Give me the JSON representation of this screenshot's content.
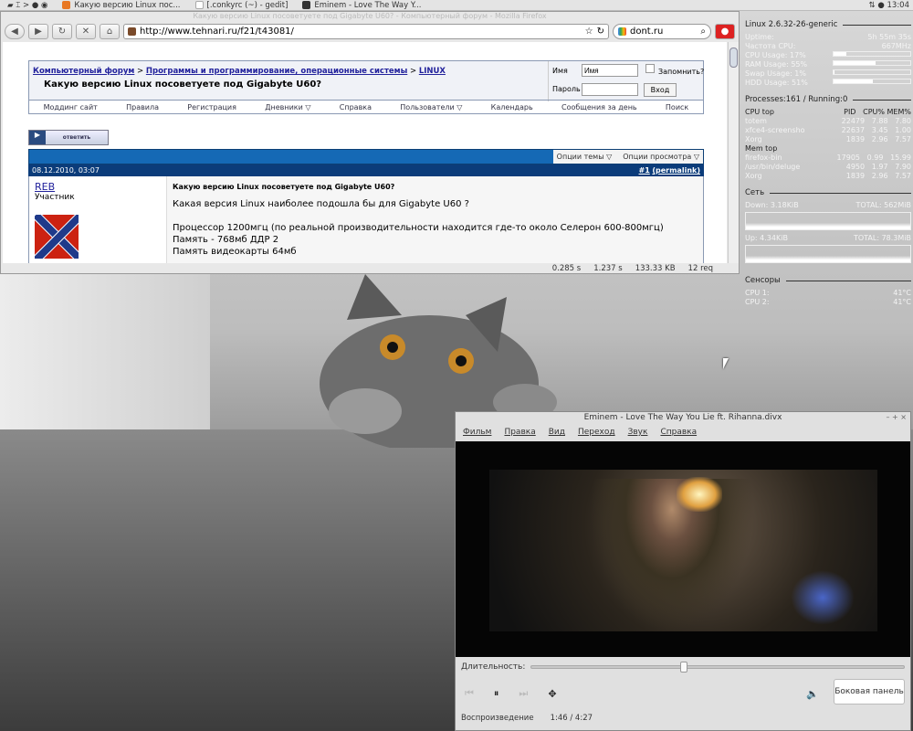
{
  "taskbar": {
    "tasks": [
      "Какую версию Linux пос...",
      "[.conkyrc (~) - gedit]",
      "Eminem - Love The Way Y..."
    ],
    "clock": "13:04"
  },
  "firefox": {
    "title": "Какую версию Linux посоветуете под Gigabyte U60? - Компьютерный форум - Mozilla Firefox",
    "url": "http://www.tehnari.ru/f21/t43081/",
    "search": "dont.ru",
    "status": [
      "0.285 s",
      "1.237 s",
      "133.33 KB",
      "12 req"
    ]
  },
  "page": {
    "crumbs": [
      "Компьютерный форум",
      "Программы и программирование, операционные системы",
      "LINUX"
    ],
    "sep": ">",
    "thread_title": "Какую версию Linux посоветуете под Gigabyte U60?",
    "login": {
      "name_label": "Имя",
      "name_value": "Имя",
      "pass_label": "Пароль",
      "remember": "Запомнить?",
      "submit": "Вход"
    },
    "nav": [
      "Моддинг сайт",
      "Правила",
      "Регистрация",
      "Дневники ▽",
      "Справка",
      "Пользователи ▽",
      "Календарь",
      "Сообщения за день",
      "Поиск"
    ],
    "reply": "ответить",
    "options": [
      "Опции темы ▽",
      "Опции просмотра ▽"
    ],
    "post": {
      "date": "08.12.2010, 03:07",
      "num": "#1",
      "permalink": "(permalink)",
      "author": "REB",
      "role": "Участник",
      "title": "Какую версию Linux посоветуете под Gigabyte U60?",
      "lines": [
        "Какая версия Linux наиболее подошла бы для Gigabyte U60 ?",
        "",
        "Процессор 1200мгц (по реальной производительности находится где-то около Селерон 600-800мгц)",
        "Память - 768мб ДДР 2",
        "Память видеокарты 64мб"
      ]
    }
  },
  "conky": {
    "kernel": "Linux 2.6.32-26-generic",
    "uptime": {
      "label": "Uptime:",
      "value": "5h 55m 35s"
    },
    "freq": {
      "label": "Частота CPU:",
      "value": "667MHz"
    },
    "usage": [
      {
        "label": "CPU Usage: 17%",
        "pct": 17
      },
      {
        "label": "RAM Usage:  55%",
        "pct": 55
      },
      {
        "label": "Swap Usage:  1%",
        "pct": 1
      },
      {
        "label": "HDD Usage:  51%",
        "pct": 51
      }
    ],
    "processes": "Processes:161  / Running:0",
    "cpu_top": {
      "title": "CPU top",
      "cols": [
        "PID",
        "CPU%",
        "MEM%"
      ],
      "rows": [
        [
          "totem",
          "22479",
          "7.88",
          "7.80"
        ],
        [
          "xfce4-screensho",
          "22637",
          "3.45",
          "1.00"
        ],
        [
          "Xorg",
          "1839",
          "2.96",
          "7.57"
        ]
      ]
    },
    "mem_top": {
      "title": "Mem top",
      "rows": [
        [
          "firefox-bin",
          "17905",
          "0.99",
          "15.99"
        ],
        [
          "/usr/bin/deluge",
          "4950",
          "1.97",
          "7.90"
        ],
        [
          "Xorg",
          "1839",
          "2.96",
          "7.57"
        ]
      ]
    },
    "net": {
      "title": "Сеть",
      "down": "Down: 3.18KiB",
      "down_total": "TOTAL: 562MiB",
      "up": "Up: 4.34KiB",
      "up_total": "TOTAL: 78.3MiB"
    },
    "sensors": {
      "title": "Сенсоры",
      "rows": [
        [
          "CPU 1:",
          "41°C"
        ],
        [
          "CPU 2:",
          "41°C"
        ]
      ]
    }
  },
  "totem": {
    "title": "Eminem - Love The Way You Lie ft. Rihanna.divx",
    "menu": [
      "Фильм",
      "Правка",
      "Вид",
      "Переход",
      "Звук",
      "Справка"
    ],
    "seek_label": "Длительность:",
    "progress": 0.4,
    "sidebar": "Боковая панель",
    "state": "Воспроизведение",
    "time": "1:46 / 4:27"
  }
}
